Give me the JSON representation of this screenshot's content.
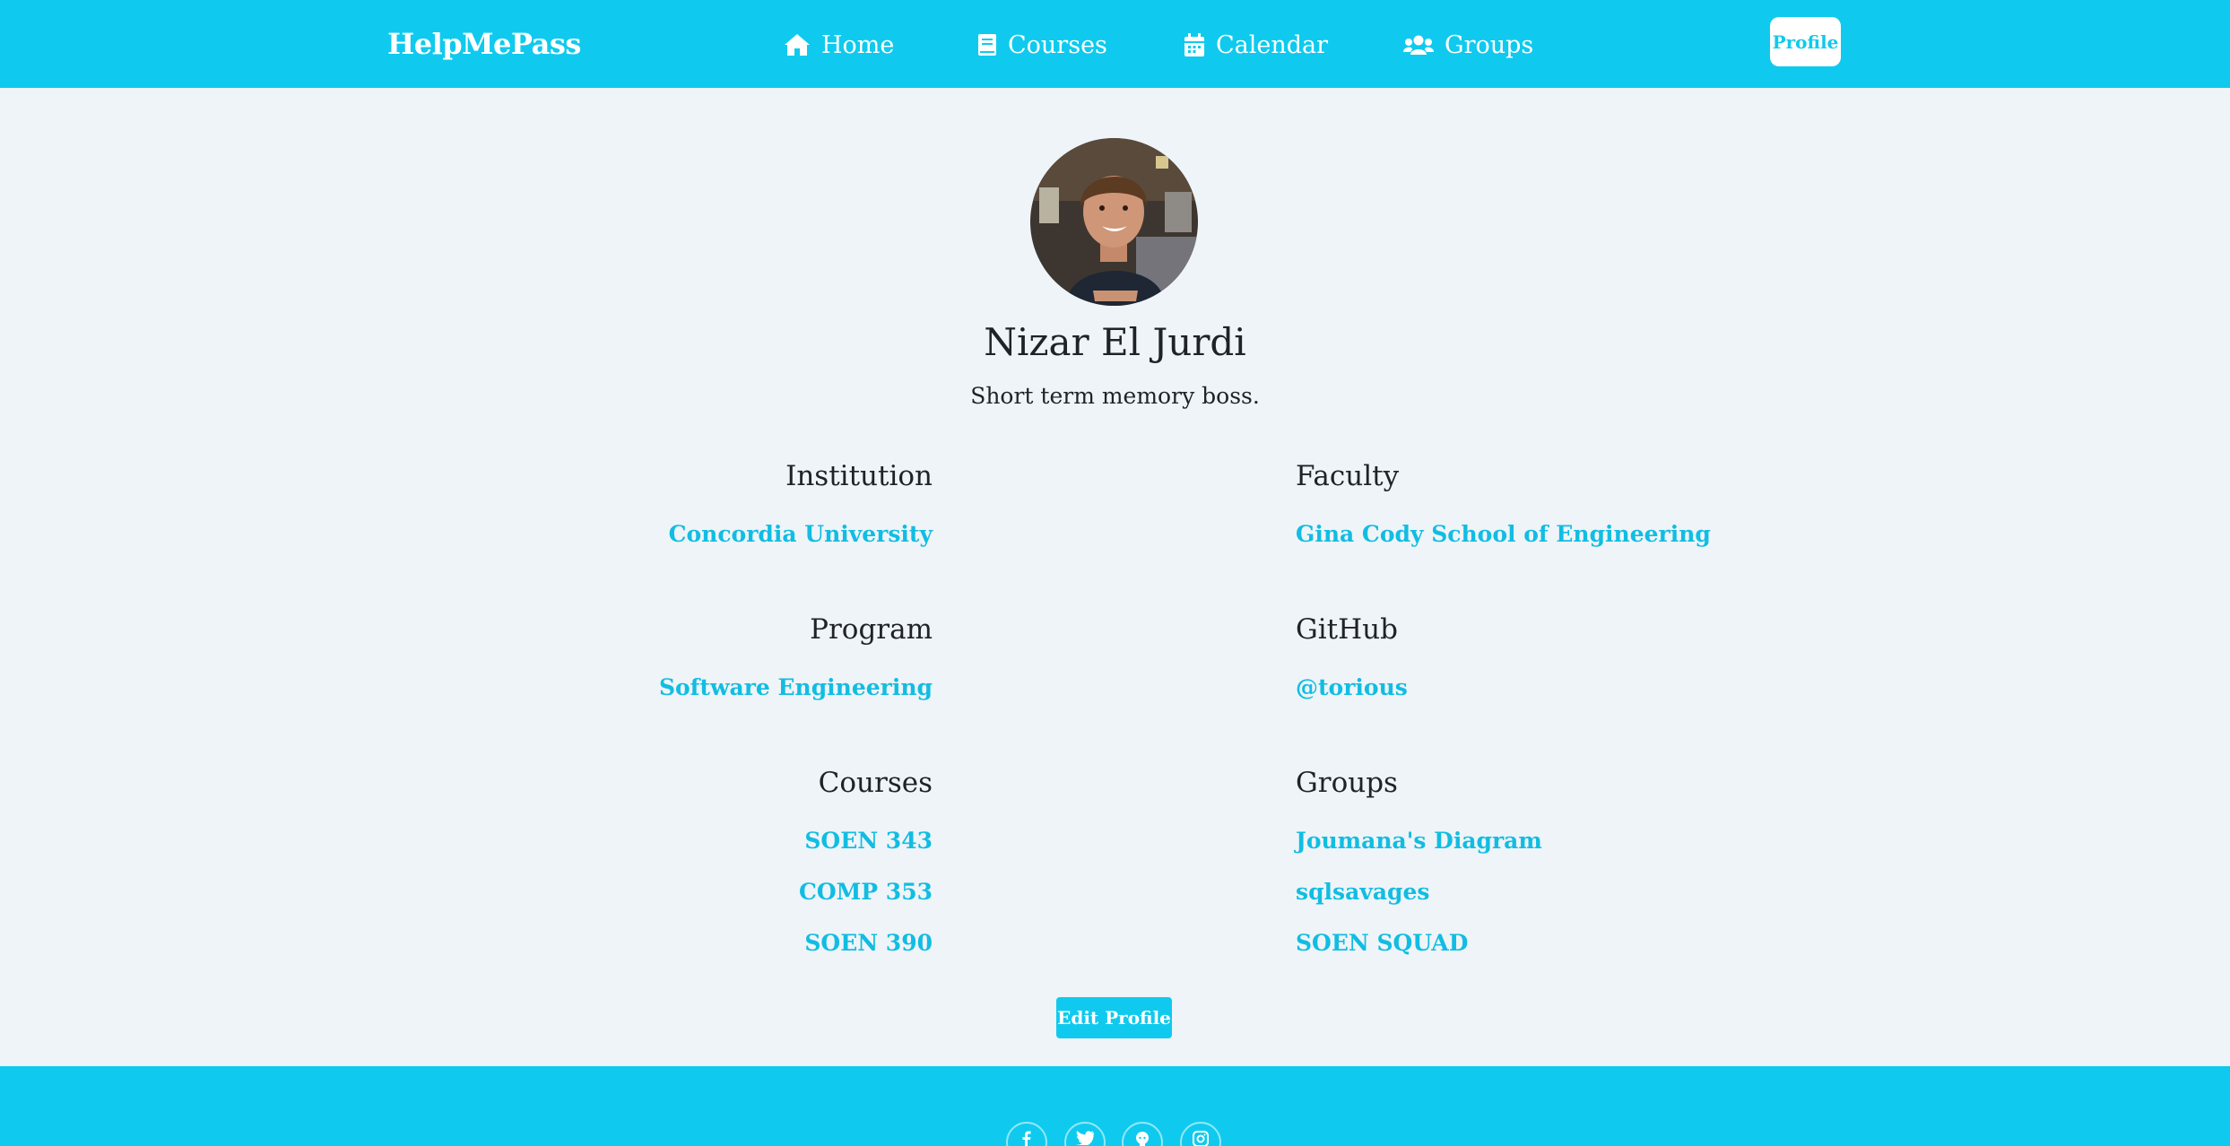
{
  "nav": {
    "brand": "HelpMePass",
    "items": [
      {
        "label": "Home",
        "icon": "home-icon"
      },
      {
        "label": "Courses",
        "icon": "book-icon"
      },
      {
        "label": "Calendar",
        "icon": "calendar-icon"
      },
      {
        "label": "Groups",
        "icon": "users-icon"
      }
    ],
    "profile_label": "Profile"
  },
  "profile": {
    "name": "Nizar El Jurdi",
    "bio": "Short term memory boss.",
    "institution": {
      "title": "Institution",
      "value": "Concordia University"
    },
    "faculty": {
      "title": "Faculty",
      "value": "Gina Cody School of Engineering"
    },
    "program": {
      "title": "Program",
      "value": "Software Engineering"
    },
    "github": {
      "title": "GitHub",
      "value": "@torious"
    },
    "courses": {
      "title": "Courses",
      "items": [
        "SOEN 343",
        "COMP 353",
        "SOEN 390"
      ]
    },
    "groups": {
      "title": "Groups",
      "items": [
        "Joumana's Diagram",
        "sqlsavages",
        "SOEN SQUAD"
      ]
    },
    "edit_label": "Edit Profile"
  },
  "footer": {
    "social_icons": [
      "facebook-icon",
      "twitter-icon",
      "github-icon",
      "instagram-icon"
    ]
  },
  "colors": {
    "accent": "#0fcaee",
    "link": "#11bde2",
    "background": "#eff4f8",
    "text": "#1f2327"
  }
}
